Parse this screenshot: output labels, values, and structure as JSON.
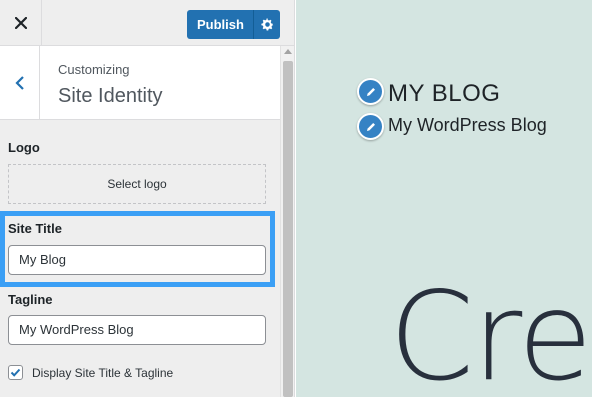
{
  "header": {
    "publish_label": "Publish"
  },
  "section": {
    "customizing_label": "Customizing",
    "title": "Site Identity"
  },
  "logo": {
    "label": "Logo",
    "button_label": "Select logo"
  },
  "site_title": {
    "label": "Site Title",
    "value": "My Blog"
  },
  "tagline": {
    "label": "Tagline",
    "value": "My WordPress Blog"
  },
  "display_option": {
    "label": "Display Site Title & Tagline",
    "checked": true
  },
  "preview": {
    "site_title": "MY BLOG",
    "tagline": "My WordPress Blog",
    "hero_text": "Cre"
  },
  "colors": {
    "accent": "#2271b1",
    "highlight": "#3b9ff5",
    "preview_bg": "#d4e5e1",
    "sidebar_bg": "#eeeeee"
  },
  "icons": [
    "close-icon",
    "gear-icon",
    "chevron-left-icon",
    "pencil-icon",
    "checkmark-icon"
  ]
}
